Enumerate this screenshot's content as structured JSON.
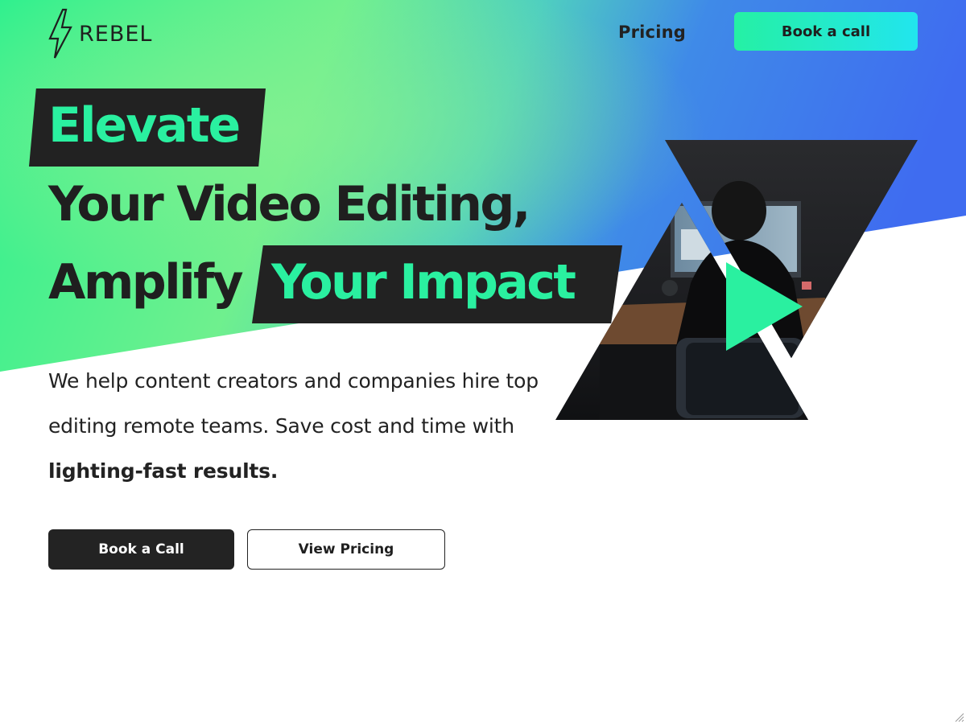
{
  "brand": {
    "logo_text": "REBEL",
    "accent": "#2af0a0",
    "blue": "#3f78f0",
    "dark": "#222222"
  },
  "header": {
    "nav_pricing": "Pricing",
    "cta_label": "Book a call"
  },
  "hero": {
    "headline_word1": "Elevate",
    "headline_line2": "Your Video Editing,",
    "headline_word3": "Amplify",
    "headline_highlight": "Your Impact",
    "description_plain": "We help content creators and companies hire top editing remote teams. Save cost and time with ",
    "description_bold": "lighting-fast results.",
    "primary_button": "Book a Call",
    "secondary_button": "View Pricing"
  },
  "icons": [
    "lightning-bolt-icon",
    "play-icon",
    "resize-grip-icon"
  ]
}
